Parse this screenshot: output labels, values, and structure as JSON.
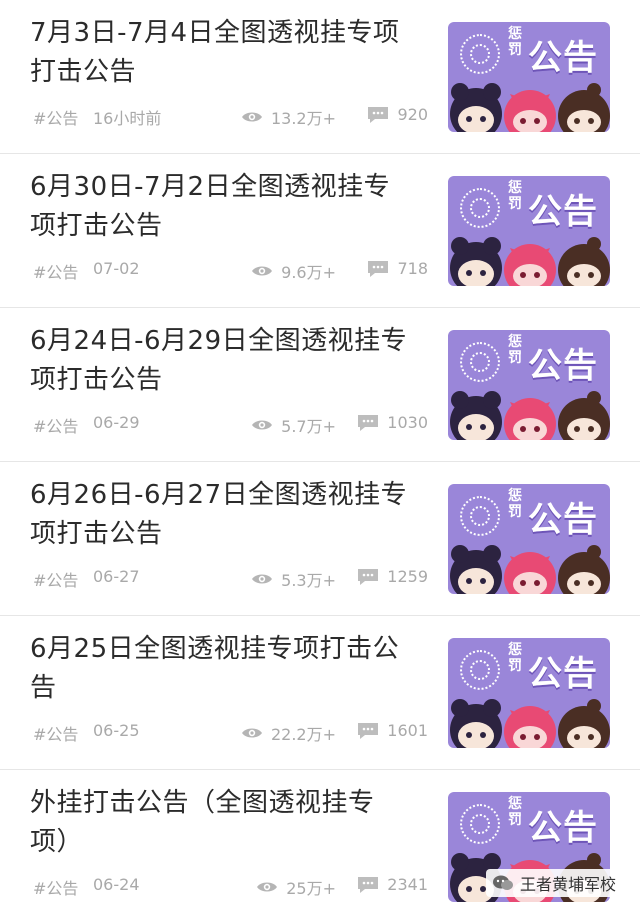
{
  "articles": [
    {
      "title": "7月3日-7月4日全图透视挂专项打击公告",
      "tag": "#公告",
      "time": "16小时前",
      "views": "13.2万+",
      "comments": "920",
      "thumb": {
        "small": "惩罚",
        "big": "公告"
      }
    },
    {
      "title": "6月30日-7月2日全图透视挂专项打击公告",
      "tag": "#公告",
      "time": "07-02",
      "views": "9.6万+",
      "comments": "718",
      "thumb": {
        "small": "惩罚",
        "big": "公告"
      }
    },
    {
      "title": "6月24日-6月29日全图透视挂专项打击公告",
      "tag": "#公告",
      "time": "06-29",
      "views": "5.7万+",
      "comments": "1030",
      "thumb": {
        "small": "惩罚",
        "big": "公告"
      }
    },
    {
      "title": "6月26日-6月27日全图透视挂专项打击公告",
      "tag": "#公告",
      "time": "06-27",
      "views": "5.3万+",
      "comments": "1259",
      "thumb": {
        "small": "惩罚",
        "big": "公告"
      }
    },
    {
      "title": "6月25日全图透视挂专项打击公告",
      "tag": "#公告",
      "time": "06-25",
      "views": "22.2万+",
      "comments": "1601",
      "thumb": {
        "small": "惩罚",
        "big": "公告"
      }
    },
    {
      "title": "外挂打击公告（全图透视挂专项）",
      "tag": "#公告",
      "time": "06-24",
      "views": "25万+",
      "comments": "2341",
      "thumb": {
        "small": "惩罚",
        "big": "公告"
      }
    }
  ],
  "watermark": {
    "text": "王者黄埔军校"
  },
  "colors": {
    "thumb_bg": "#9a86d9",
    "meta": "#a9a9a9",
    "title": "#2b2b2b"
  }
}
